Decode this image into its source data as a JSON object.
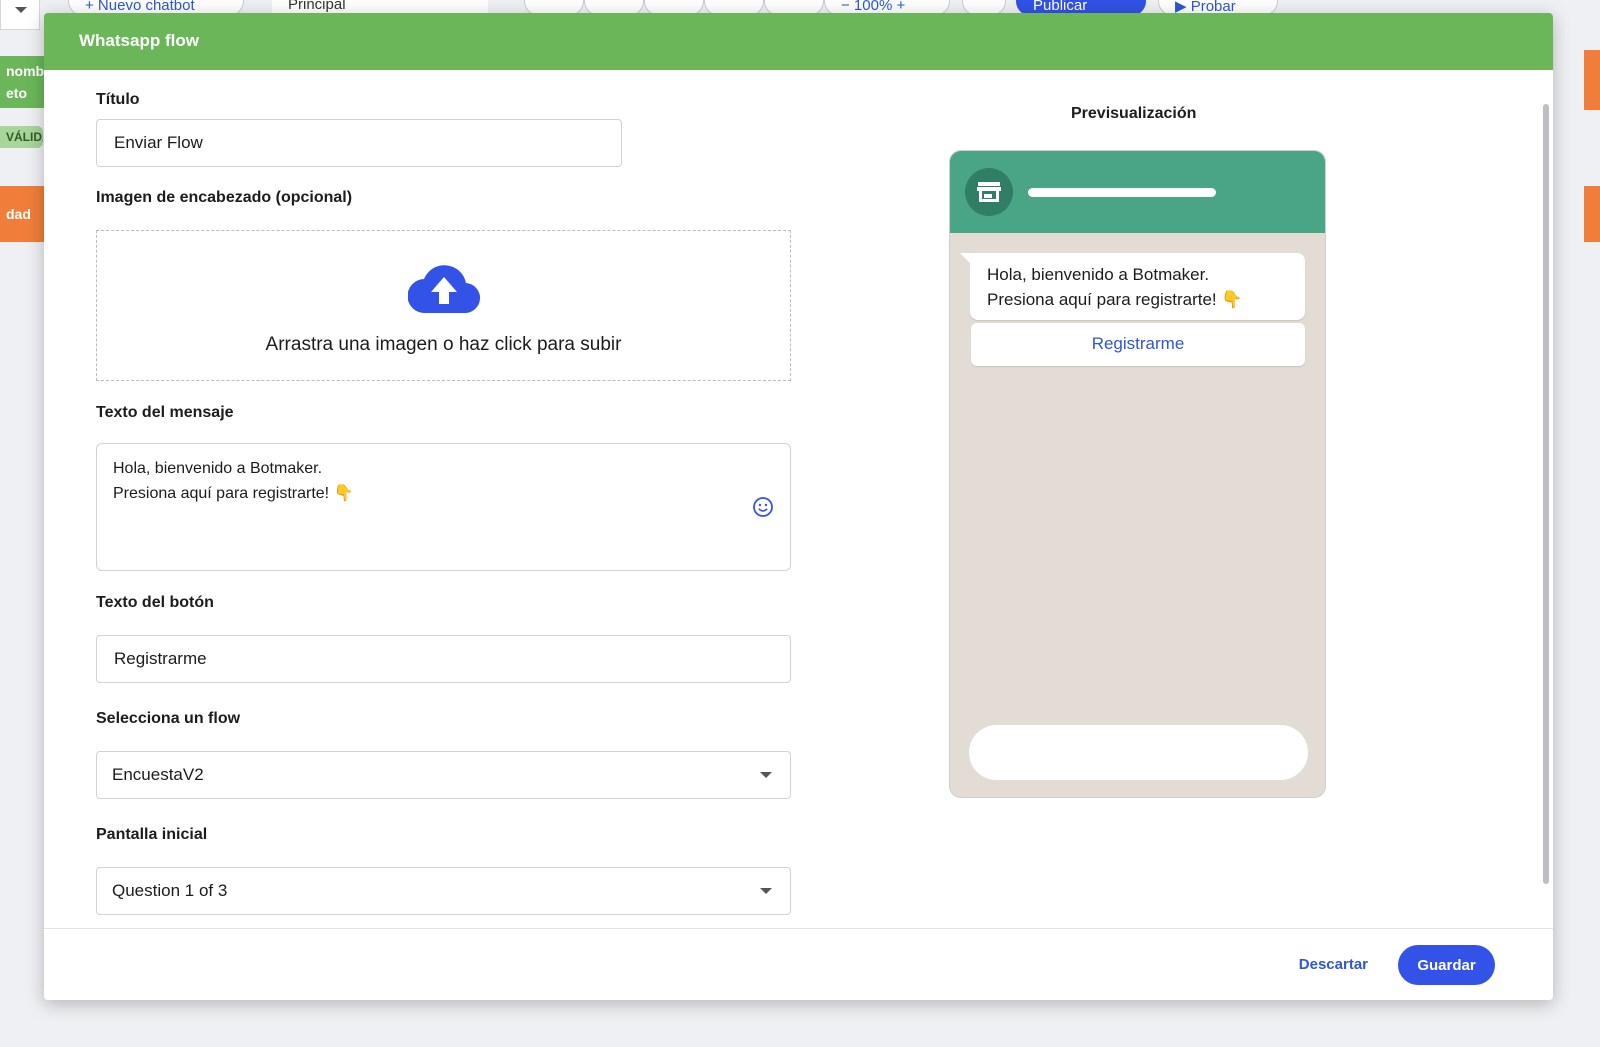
{
  "background": {
    "toolbar": {
      "new_chatbot": "+ Nuevo chatbot",
      "main_select": "Principal",
      "zoom": "− 100% +",
      "publish": "Publicar",
      "test": "▶ Probar"
    },
    "left_tags": [
      "nombre",
      "eto",
      "VÁLIDA",
      "dad"
    ]
  },
  "modal": {
    "title": "Whatsapp flow",
    "form": {
      "title_label": "Título",
      "title_value": "Enviar Flow",
      "header_image_label": "Imagen de encabezado (opcional)",
      "upload_text": "Arrastra una imagen o haz click para subir",
      "message_label": "Texto del mensaje",
      "message_line1": "Hola, bienvenido a Botmaker.",
      "message_line2": "Presiona aquí para registrarte! 👇",
      "button_label": "Texto del botón",
      "button_value": "Registrarme",
      "flow_label": "Selecciona un flow",
      "flow_value": "EncuestaV2",
      "screen_label": "Pantalla inicial",
      "screen_value": "Question 1 of 3"
    },
    "preview": {
      "title": "Previsualización",
      "bubble_line1": "Hola, bienvenido a Botmaker.",
      "bubble_line2": "Presiona aquí para registrarte! 👇",
      "bubble_button": "Registrarme"
    },
    "footer": {
      "discard": "Descartar",
      "save": "Guardar"
    }
  },
  "colors": {
    "header_green": "#6ab659",
    "phone_header": "#4aa587",
    "chat_background": "#e3dcd5",
    "accent_blue": "#3252e8"
  },
  "icons": [
    "cloud-upload-icon",
    "emoji-icon",
    "store-icon",
    "caret-down-icon"
  ]
}
